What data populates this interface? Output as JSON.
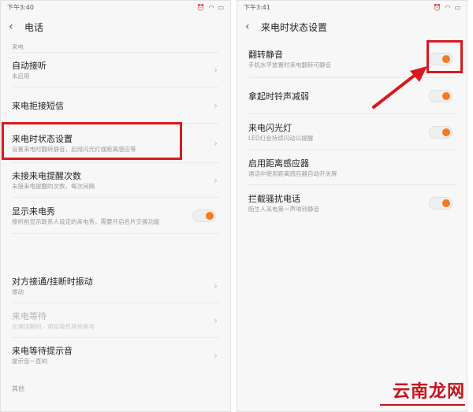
{
  "left": {
    "status_time": "下午3:40",
    "title": "电话",
    "items": [
      {
        "title": "",
        "sub": "来电"
      },
      {
        "title": "自动接听",
        "sub": "未启用"
      },
      {
        "title": "来电拒接短信",
        "sub": ""
      },
      {
        "title": "来电时状态设置",
        "sub": "设置来电时翻转静音，启用闪光灯或距离感应等"
      },
      {
        "title": "未接来电提醒次数",
        "sub": "未接来电提醒的次数，每次间隔"
      },
      {
        "title": "显示来电秀",
        "sub": "接听前显示联系人设定的来电秀，需要开启名片交换功能"
      },
      {
        "title": "对方接通/挂断时振动",
        "sub": "振动"
      },
      {
        "title": "来电等待",
        "sub": "在通话期间，通知我有其他来电"
      },
      {
        "title": "来电等待提示音",
        "sub": "提示音一直响"
      }
    ],
    "section_other": "其他"
  },
  "right": {
    "status_time": "下午3:41",
    "title": "来电时状态设置",
    "items": [
      {
        "title": "翻转静音",
        "sub": "手机水平放置时来电翻转可静音"
      },
      {
        "title": "拿起时铃声减弱",
        "sub": ""
      },
      {
        "title": "来电闪光灯",
        "sub": "LED灯会持续闪动以提醒"
      },
      {
        "title": "启用距离感应器",
        "sub": "通话中使用距离感应器自动开关屏"
      },
      {
        "title": "拦截骚扰电话",
        "sub": "陌生人来电第一声响铃静音"
      }
    ]
  },
  "icons": {
    "back": "chevron-left-icon",
    "chevron": "chevron-right-icon"
  },
  "colors": {
    "toggle_on": "#f47a1f",
    "highlight": "#d9191f",
    "watermark": "#c6121e"
  },
  "watermark": "云南龙网"
}
